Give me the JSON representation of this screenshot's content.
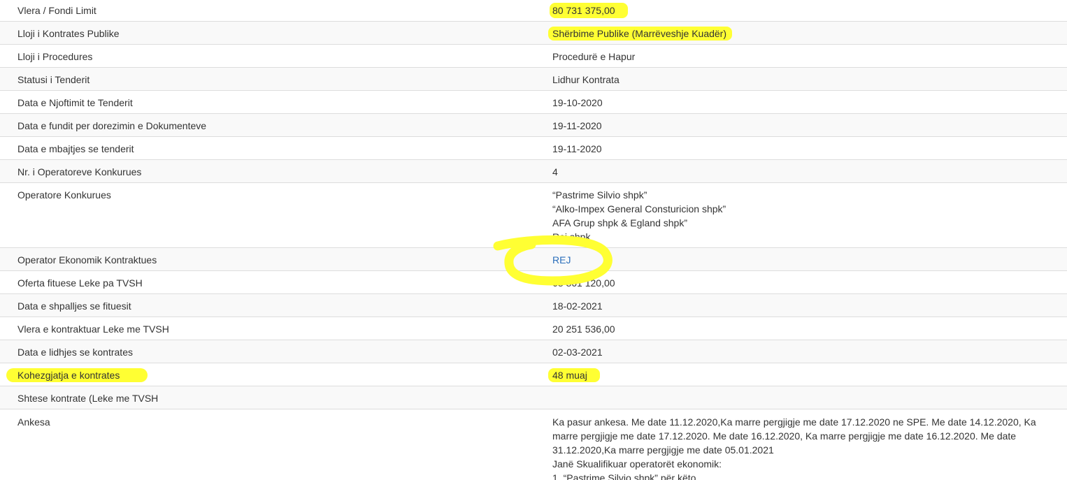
{
  "highlight_color": "#ffff33",
  "link_color": "#2a6ebb",
  "rows": [
    {
      "label": "Vlera / Fondi Limit",
      "value": "80 731 375,00"
    },
    {
      "label": "Lloji i Kontrates Publike",
      "value": "Shërbime Publike (Marrëveshje Kuadër)"
    },
    {
      "label": "Lloji i Procedures",
      "value": "Procedurë e Hapur"
    },
    {
      "label": "Statusi i Tenderit",
      "value": "Lidhur Kontrata"
    },
    {
      "label": "Data e Njoftimit te Tenderit",
      "value": "19-10-2020"
    },
    {
      "label": "Data e fundit per dorezimin e Dokumenteve",
      "value": "19-11-2020"
    },
    {
      "label": "Data e mbajtjes se tenderit",
      "value": "19-11-2020"
    },
    {
      "label": "Nr. i Operatoreve Konkurues",
      "value": "4"
    },
    {
      "label": "Operatore Konkurues",
      "lines": [
        "“Pastrime Silvio shpk”",
        "“Alko-Impex General Consturicion shpk”",
        "AFA Grup shpk & Egland shpk”",
        "Rej shpk"
      ]
    },
    {
      "label": "Operator Ekonomik Kontraktues",
      "value": "REJ"
    },
    {
      "label": "Oferta fituese Leke pa TVSH",
      "value": "68 861 120,00"
    },
    {
      "label": "Data e shpalljes se fituesit",
      "value": "18-02-2021"
    },
    {
      "label": "Vlera e kontraktuar Leke me TVSH",
      "value": "20 251 536,00"
    },
    {
      "label": "Data e lidhjes se kontrates",
      "value": "02-03-2021"
    },
    {
      "label": "Kohezgjatja e kontrates",
      "value": "48 muaj"
    },
    {
      "label": "Shtese kontrate (Leke me TVSH",
      "value": ""
    },
    {
      "label": "Ankesa",
      "lines": [
        "Ka pasur ankesa. Me date 11.12.2020,Ka marre pergjigje me date 17.12.2020 ne SPE. Me date 14.12.2020, Ka",
        "marre pergjigje me date 17.12.2020. Me date 16.12.2020, Ka marre pergjigje me date 16.12.2020. Me date",
        "31.12.2020,Ka marre pergjigje me date 05.01.2021",
        "Janë Skualifikuar operatorët ekonomik:",
        "1. “Pastrime Silvio shpk” për këto"
      ]
    }
  ]
}
